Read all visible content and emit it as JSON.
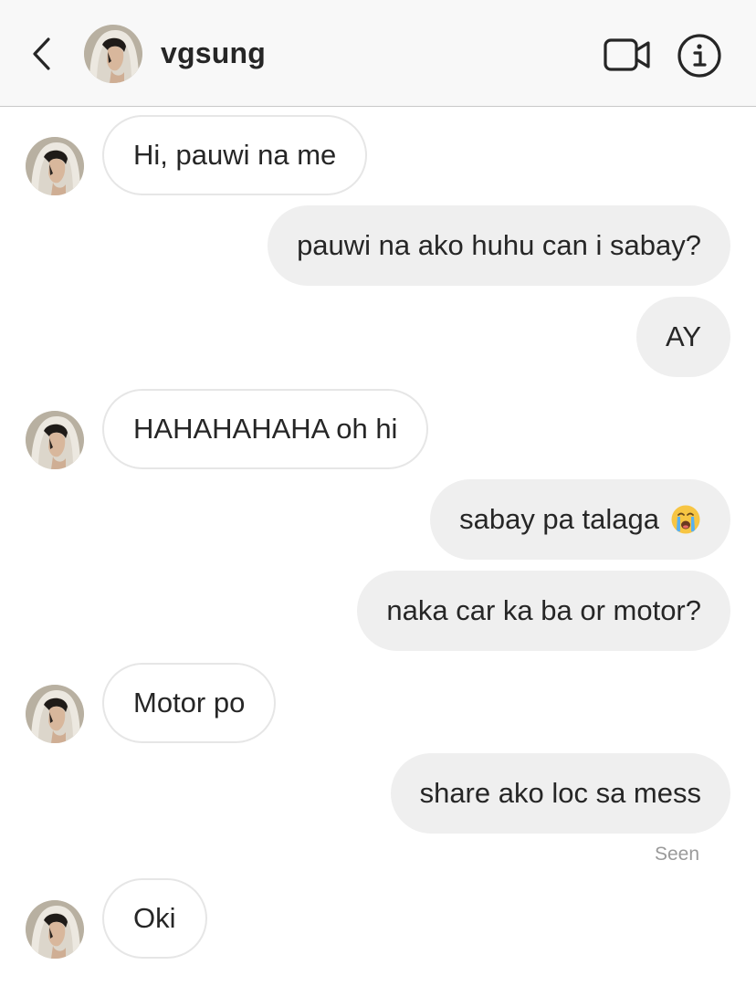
{
  "header": {
    "username": "vgsung"
  },
  "messages": [
    {
      "text": "Hi, pauwi na me"
    },
    {
      "text": "pauwi na ako huhu can i sabay?"
    },
    {
      "text": "AY"
    },
    {
      "text": "HAHAHAHAHA oh hi"
    },
    {
      "text": "sabay pa talaga",
      "emoji": "loudly-crying-face"
    },
    {
      "text": "naka car ka ba or motor?"
    },
    {
      "text": "Motor po"
    },
    {
      "text": "share ako loc sa mess"
    },
    {
      "text": "Oki"
    }
  ],
  "status": {
    "seen_label": "Seen"
  },
  "colors": {
    "header_bg": "#f8f8f8",
    "outgoing_bubble": "#efefef",
    "incoming_border": "#e6e6e6",
    "text": "#262626",
    "seen_text": "#9a9a9a"
  }
}
